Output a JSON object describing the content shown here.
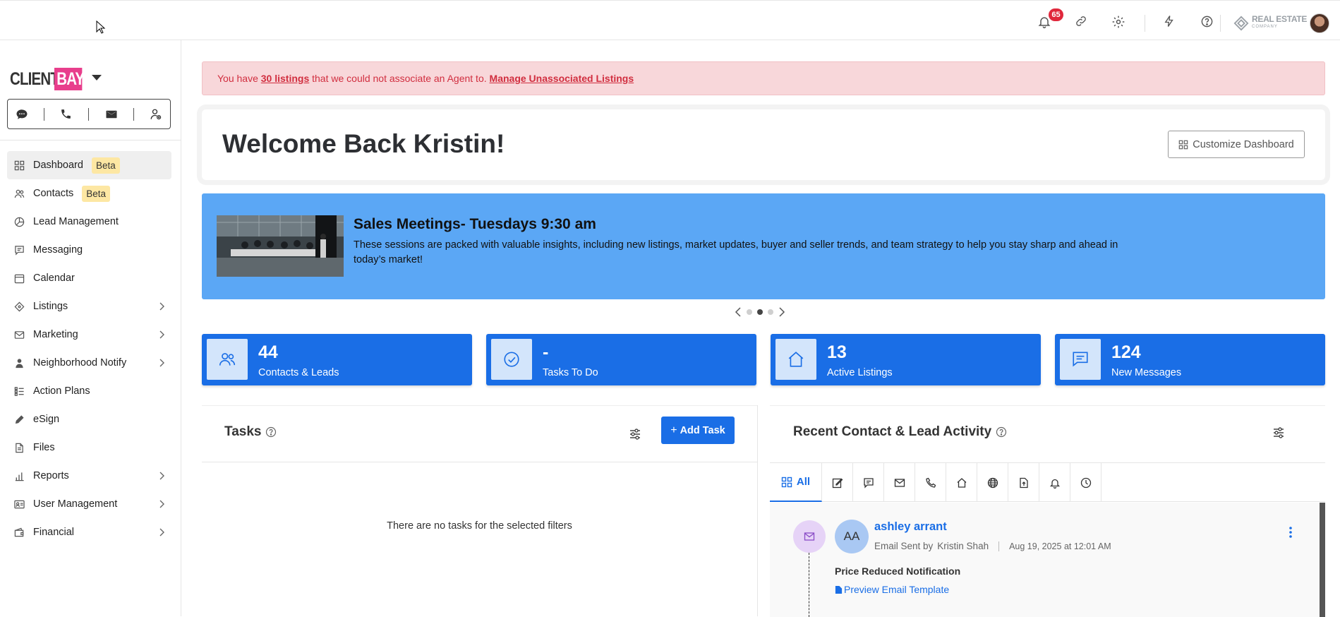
{
  "topbar": {
    "notification_count": "65",
    "brand_text": "REAL ESTATE",
    "brand_subtext": "COMPANY"
  },
  "sidebar": {
    "logo_client": "CLIENT",
    "logo_bay": "BAY",
    "items": [
      {
        "label": "Dashboard",
        "badge": "Beta",
        "icon": "grid-icon"
      },
      {
        "label": "Contacts",
        "badge": "Beta",
        "icon": "users-icon"
      },
      {
        "label": "Lead Management",
        "icon": "pie-chart-icon"
      },
      {
        "label": "Messaging",
        "icon": "message-icon"
      },
      {
        "label": "Calendar",
        "icon": "calendar-icon"
      },
      {
        "label": "Listings",
        "icon": "listings-icon"
      },
      {
        "label": "Marketing",
        "icon": "marketing-icon"
      },
      {
        "label": "Neighborhood Notify",
        "icon": "person-pin-icon"
      },
      {
        "label": "Action Plans",
        "icon": "action-plans-icon"
      },
      {
        "label": "eSign",
        "icon": "pen-icon"
      },
      {
        "label": "Files",
        "icon": "file-icon"
      },
      {
        "label": "Reports",
        "icon": "bar-chart-icon"
      },
      {
        "label": "User Management",
        "icon": "id-card-icon"
      },
      {
        "label": "Financial",
        "icon": "wallet-icon"
      }
    ]
  },
  "alert": {
    "prefix": "You have",
    "count_link": "30 listings",
    "middle": "that we could not associate an Agent to.",
    "action_link": "Manage Unassociated Listings"
  },
  "welcome": {
    "title": "Welcome Back Kristin!",
    "customize_label": "Customize Dashboard"
  },
  "banner": {
    "title": "Sales Meetings- Tuesdays 9:30 am",
    "body": "These sessions are packed with valuable insights, including new listings, market updates, buyer and seller trends, and team strategy to help you stay sharp and ahead in today’s market!",
    "active_slide": 2,
    "slide_count": 3
  },
  "stats": [
    {
      "value": "44",
      "label": "Contacts & Leads",
      "icon": "users-icon"
    },
    {
      "value": "-",
      "label": "Tasks To Do",
      "icon": "check-circle-icon"
    },
    {
      "value": "13",
      "label": "Active Listings",
      "icon": "house-icon"
    },
    {
      "value": "124",
      "label": "New Messages",
      "icon": "chat-icon"
    }
  ],
  "tasks": {
    "title": "Tasks",
    "add_label": "Add Task",
    "empty": "There are no tasks for the selected filters"
  },
  "activity": {
    "title": "Recent Contact & Lead Activity",
    "all_tab": "All",
    "entry": {
      "initials": "AA",
      "name": "ashley arrant",
      "action": "Email Sent by",
      "by": "Kristin Shah",
      "date": "Aug 19, 2025 at 12:01 AM",
      "subject": "Price Reduced Notification",
      "preview_link": "Preview Email Template"
    }
  }
}
